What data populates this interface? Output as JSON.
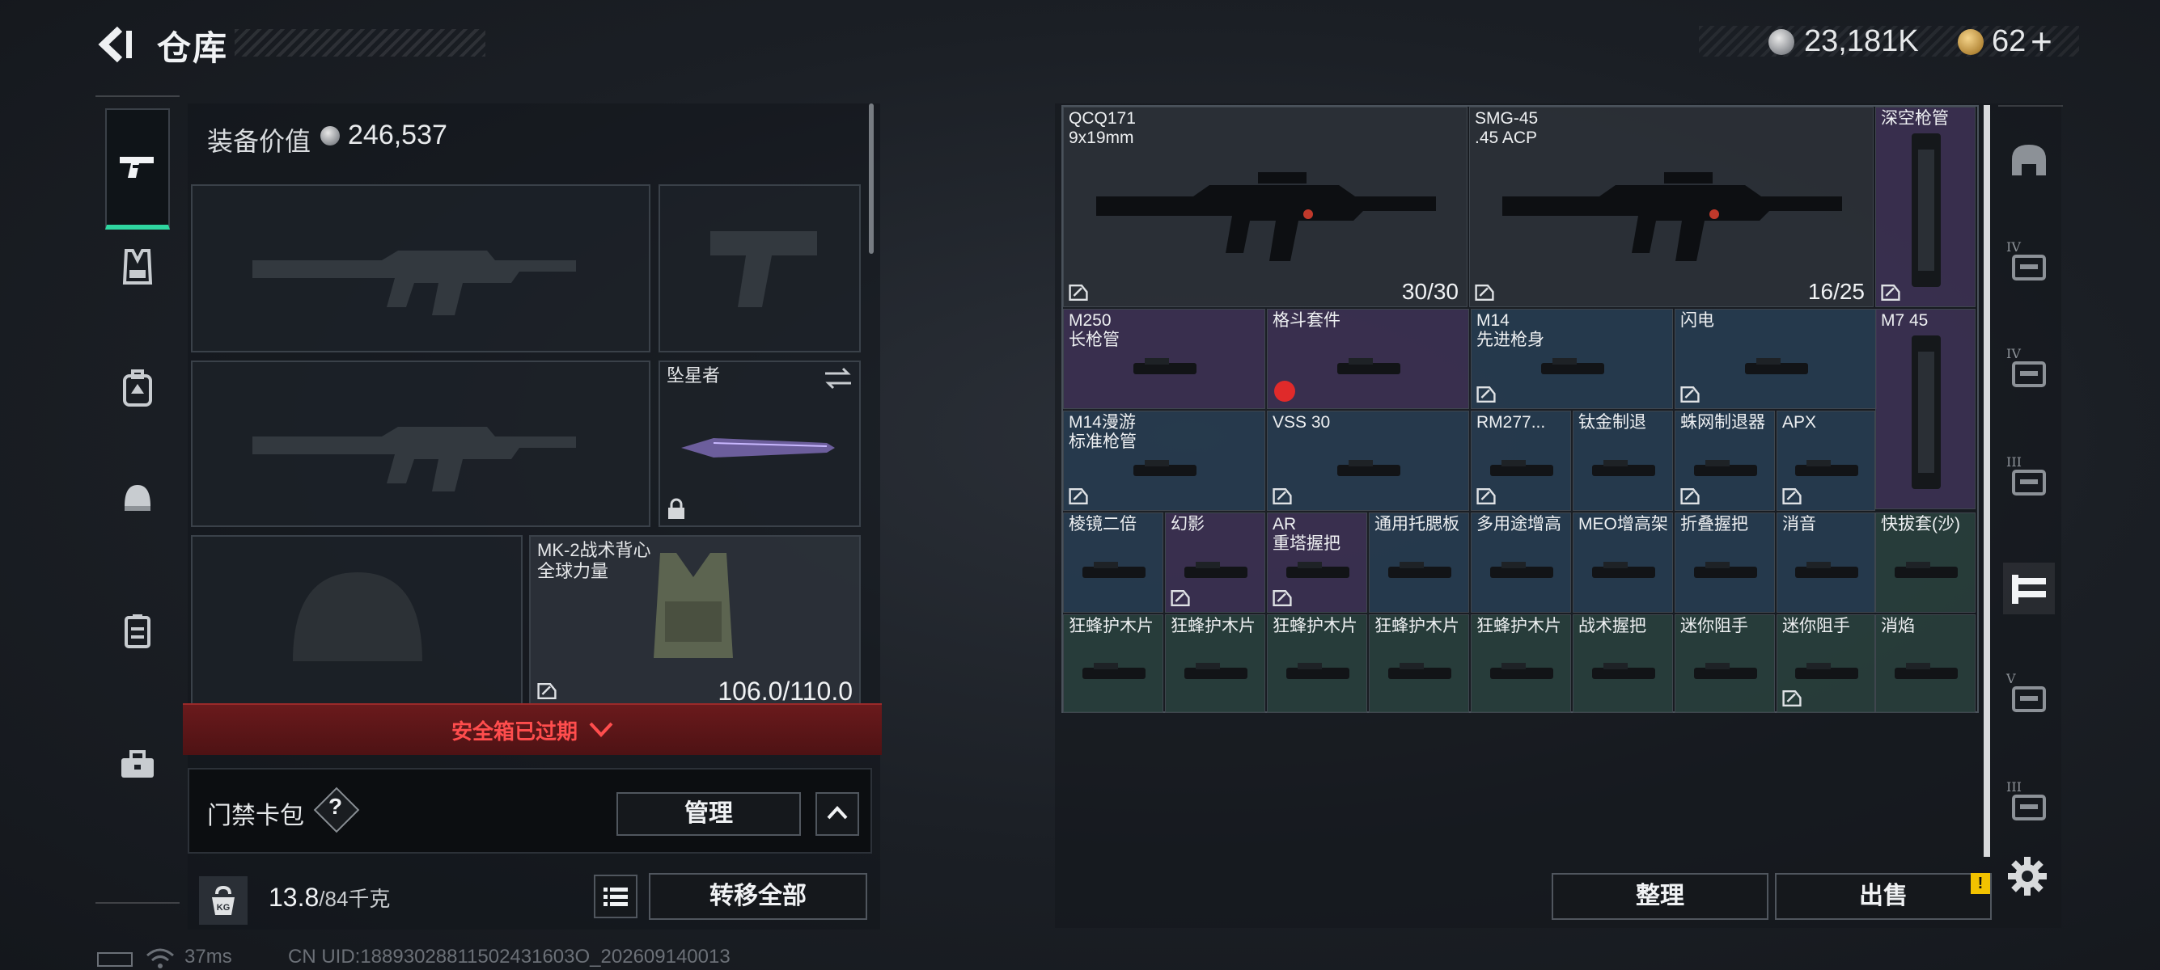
{
  "header": {
    "title": "仓库",
    "currencies": [
      {
        "icon": "silver-coin-icon",
        "value": "23,181K"
      },
      {
        "icon": "gold-coin-icon",
        "value": "62"
      }
    ],
    "add_label": "+"
  },
  "left_nav": {
    "items": [
      {
        "name": "weapons",
        "icon": "pistol-icon",
        "active": true
      },
      {
        "name": "armor",
        "icon": "vest-icon"
      },
      {
        "name": "backpack",
        "icon": "backpack-icon"
      },
      {
        "name": "helmet",
        "icon": "helmet-icon"
      },
      {
        "name": "case",
        "icon": "container-icon"
      },
      {
        "name": "toolbox",
        "icon": "toolbox-icon"
      }
    ]
  },
  "loadout": {
    "equip_value_label": "装备价值",
    "equip_value": "246,537",
    "melee": {
      "name": "坠星者",
      "locked": true
    },
    "vest": {
      "name_line1": "MK-2战术背心",
      "name_line2": "全球力量",
      "durability": "106.0/110.0"
    },
    "safe_box_text": "安全箱已过期",
    "keycard": {
      "label": "门禁卡包",
      "help": "?",
      "manage_label": "管理"
    },
    "weight": {
      "current": "13.8",
      "max": "/84千克",
      "unit_icon": "KG"
    },
    "transfer_all_label": "转移全部"
  },
  "status": {
    "ping": "37ms",
    "uid": "CN UID:18893028811502431603O_202609140013"
  },
  "storage": {
    "items": [
      {
        "name": "QCQ171\n9x19mm",
        "count": "30/30",
        "color": "gray",
        "tag": true
      },
      {
        "name": "SMG-45\n.45 ACP",
        "count": "16/25",
        "color": "gray",
        "tag": true
      },
      {
        "name": "深空枪管",
        "color": "purple",
        "tag": true
      },
      {
        "name": "M250\n长枪管",
        "color": "purple"
      },
      {
        "name": "格斗套件",
        "color": "purple",
        "timer": true
      },
      {
        "name": "M14\n先进枪身",
        "color": "blue",
        "tag": true
      },
      {
        "name": "闪电",
        "color": "blue",
        "tag": true
      },
      {
        "name": "M7 45",
        "color": "purple"
      },
      {
        "name": "M14漫游\n标准枪管",
        "color": "blue",
        "tag": true
      },
      {
        "name": "VSS 30",
        "color": "blue",
        "tag": true
      },
      {
        "name": "RM277...",
        "color": "blue",
        "tag": true
      },
      {
        "name": "钛金制退",
        "color": "blue"
      },
      {
        "name": "蛛网制退器",
        "color": "blue",
        "tag": true
      },
      {
        "name": "APX",
        "color": "blue",
        "tag": true
      },
      {
        "name": "棱镜二倍",
        "color": "blue"
      },
      {
        "name": "幻影",
        "color": "purple",
        "tag": true
      },
      {
        "name": "AR\n重塔握把",
        "color": "purple",
        "tag": true
      },
      {
        "name": "通用托腮板",
        "color": "blue"
      },
      {
        "name": "多用途增高",
        "color": "blue"
      },
      {
        "name": "MEO增高架",
        "color": "blue"
      },
      {
        "name": "折叠握把",
        "color": "blue"
      },
      {
        "name": "消音",
        "color": "blue"
      },
      {
        "name": "快拔套(沙)",
        "color": "green"
      },
      {
        "name": "狂蜂护木片",
        "color": "green"
      },
      {
        "name": "狂蜂护木片",
        "color": "green"
      },
      {
        "name": "狂蜂护木片",
        "color": "green"
      },
      {
        "name": "狂蜂护木片",
        "color": "green"
      },
      {
        "name": "狂蜂护木片",
        "color": "green"
      },
      {
        "name": "战术握把",
        "color": "green"
      },
      {
        "name": "迷你阻手",
        "color": "green"
      },
      {
        "name": "迷你阻手",
        "color": "green",
        "tag": true
      },
      {
        "name": "消焰",
        "color": "green"
      }
    ],
    "tidy_label": "整理",
    "sell_label": "出售",
    "sell_warning": "!"
  },
  "right_rail": {
    "items": [
      {
        "icon": "helmet-icon",
        "label": ""
      },
      {
        "icon": "add-storage-icon",
        "label": "IV"
      },
      {
        "icon": "storage-tier-icon",
        "label": "IV"
      },
      {
        "icon": "storage-tier-icon",
        "label": "III"
      },
      {
        "icon": "weapon-rack-icon",
        "label": "",
        "active": true
      },
      {
        "icon": "storage-tier-icon",
        "label": "V"
      },
      {
        "icon": "storage-tier-icon",
        "label": "III"
      }
    ]
  },
  "colors": {
    "accent": "#2fd6a0",
    "warning": "#ff4d4d",
    "rare_purple": "#3e3256",
    "rare_blue": "#283e54",
    "rare_green": "#2a423e"
  }
}
